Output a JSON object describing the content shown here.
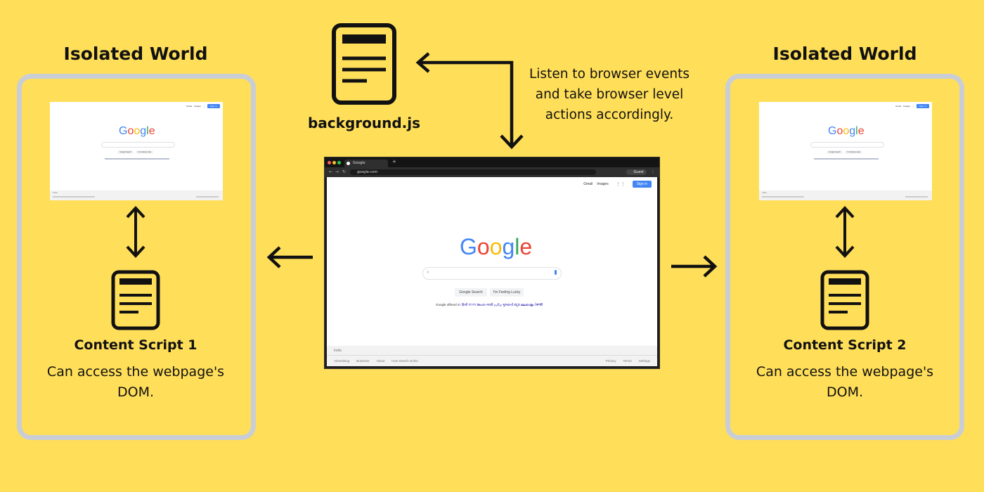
{
  "left_world": {
    "title": "Isolated World",
    "script_label": "Content Script 1",
    "description": "Can access the webpage's DOM."
  },
  "right_world": {
    "title": "Isolated World",
    "script_label": "Content Script 2",
    "description": "Can access the webpage's DOM."
  },
  "background": {
    "label": "background.js",
    "note_line1": "Listen to browser events",
    "note_line2": "and take browser level",
    "note_line3": "actions accordingly."
  },
  "browser": {
    "tab_title": "Google",
    "url": "google.com",
    "profile": "Guest",
    "gmail": "Gmail",
    "images": "Images",
    "signin": "Sign in",
    "logo": [
      "G",
      "o",
      "o",
      "g",
      "l",
      "e"
    ],
    "search_button": "Google Search",
    "lucky_button": "I'm Feeling Lucky",
    "offered_in": "Google offered in:",
    "languages": [
      "हिन्दी",
      "বাংলা",
      "తెలుగు",
      "मराठी",
      "தமிழ்",
      "ગુજરાતી",
      "ಕನ್ನಡ",
      "മലയാളം",
      "ਪੰਜਾਬੀ"
    ],
    "country": "India",
    "footer_left": [
      "Advertising",
      "Business",
      "About",
      "How Search works"
    ],
    "footer_right": [
      "Privacy",
      "Terms",
      "Settings"
    ]
  },
  "colors": {
    "background": "#FFDE59",
    "box_border": "#C9CED6",
    "ink": "#111111"
  }
}
